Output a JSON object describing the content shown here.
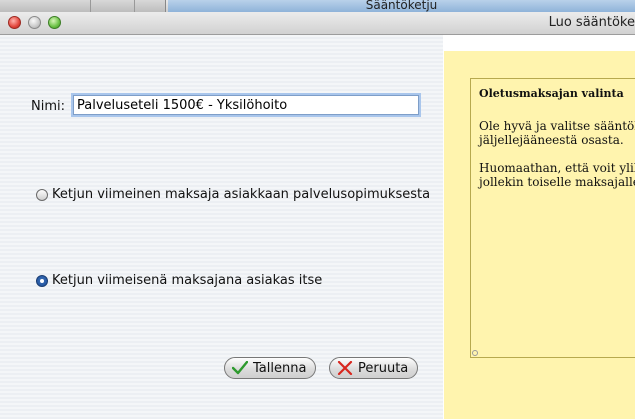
{
  "background_window": {
    "title": "Sääntöketju"
  },
  "window": {
    "title": "Luo sääntöke"
  },
  "form": {
    "name_label": "Nimi:",
    "name_value": "Palveluseteli 1500€ - Yksilöhoito",
    "options": [
      {
        "label": "Ketjun viimeinen maksaja asiakkaan palvelusopimuksesta",
        "checked": false
      },
      {
        "label": "Ketjun viimeisenä maksajana asiakas itse",
        "checked": true
      }
    ],
    "buttons": {
      "save_label": "Tallenna",
      "cancel_label": "Peruuta"
    }
  },
  "help": {
    "title": "Oletusmaksajan valinta",
    "paragraph1_line1": "Ole hyvä ja valitse sääntöke",
    "paragraph1_line2": "jäljellejääneestä osasta.",
    "paragraph2_line1": "Huomaathan, että voit ylikir",
    "paragraph2_line2": "jollekin toiselle maksajalle."
  },
  "colors": {
    "help_background": "#fff4ae",
    "accent": "#1d4f9c",
    "save_icon": "#2e9a2e",
    "cancel_icon": "#d8261e"
  }
}
